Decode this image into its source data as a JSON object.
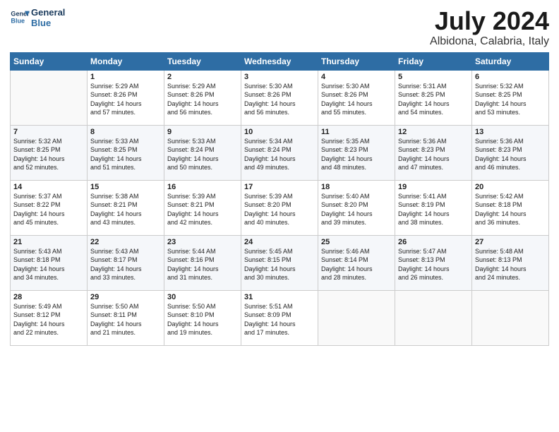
{
  "logo": {
    "line1": "General",
    "line2": "Blue"
  },
  "title": "July 2024",
  "location": "Albidona, Calabria, Italy",
  "header_days": [
    "Sunday",
    "Monday",
    "Tuesday",
    "Wednesday",
    "Thursday",
    "Friday",
    "Saturday"
  ],
  "weeks": [
    [
      {
        "day": "",
        "info": ""
      },
      {
        "day": "1",
        "info": "Sunrise: 5:29 AM\nSunset: 8:26 PM\nDaylight: 14 hours\nand 57 minutes."
      },
      {
        "day": "2",
        "info": "Sunrise: 5:29 AM\nSunset: 8:26 PM\nDaylight: 14 hours\nand 56 minutes."
      },
      {
        "day": "3",
        "info": "Sunrise: 5:30 AM\nSunset: 8:26 PM\nDaylight: 14 hours\nand 56 minutes."
      },
      {
        "day": "4",
        "info": "Sunrise: 5:30 AM\nSunset: 8:26 PM\nDaylight: 14 hours\nand 55 minutes."
      },
      {
        "day": "5",
        "info": "Sunrise: 5:31 AM\nSunset: 8:25 PM\nDaylight: 14 hours\nand 54 minutes."
      },
      {
        "day": "6",
        "info": "Sunrise: 5:32 AM\nSunset: 8:25 PM\nDaylight: 14 hours\nand 53 minutes."
      }
    ],
    [
      {
        "day": "7",
        "info": "Sunrise: 5:32 AM\nSunset: 8:25 PM\nDaylight: 14 hours\nand 52 minutes."
      },
      {
        "day": "8",
        "info": "Sunrise: 5:33 AM\nSunset: 8:25 PM\nDaylight: 14 hours\nand 51 minutes."
      },
      {
        "day": "9",
        "info": "Sunrise: 5:33 AM\nSunset: 8:24 PM\nDaylight: 14 hours\nand 50 minutes."
      },
      {
        "day": "10",
        "info": "Sunrise: 5:34 AM\nSunset: 8:24 PM\nDaylight: 14 hours\nand 49 minutes."
      },
      {
        "day": "11",
        "info": "Sunrise: 5:35 AM\nSunset: 8:23 PM\nDaylight: 14 hours\nand 48 minutes."
      },
      {
        "day": "12",
        "info": "Sunrise: 5:36 AM\nSunset: 8:23 PM\nDaylight: 14 hours\nand 47 minutes."
      },
      {
        "day": "13",
        "info": "Sunrise: 5:36 AM\nSunset: 8:23 PM\nDaylight: 14 hours\nand 46 minutes."
      }
    ],
    [
      {
        "day": "14",
        "info": "Sunrise: 5:37 AM\nSunset: 8:22 PM\nDaylight: 14 hours\nand 45 minutes."
      },
      {
        "day": "15",
        "info": "Sunrise: 5:38 AM\nSunset: 8:21 PM\nDaylight: 14 hours\nand 43 minutes."
      },
      {
        "day": "16",
        "info": "Sunrise: 5:39 AM\nSunset: 8:21 PM\nDaylight: 14 hours\nand 42 minutes."
      },
      {
        "day": "17",
        "info": "Sunrise: 5:39 AM\nSunset: 8:20 PM\nDaylight: 14 hours\nand 40 minutes."
      },
      {
        "day": "18",
        "info": "Sunrise: 5:40 AM\nSunset: 8:20 PM\nDaylight: 14 hours\nand 39 minutes."
      },
      {
        "day": "19",
        "info": "Sunrise: 5:41 AM\nSunset: 8:19 PM\nDaylight: 14 hours\nand 38 minutes."
      },
      {
        "day": "20",
        "info": "Sunrise: 5:42 AM\nSunset: 8:18 PM\nDaylight: 14 hours\nand 36 minutes."
      }
    ],
    [
      {
        "day": "21",
        "info": "Sunrise: 5:43 AM\nSunset: 8:18 PM\nDaylight: 14 hours\nand 34 minutes."
      },
      {
        "day": "22",
        "info": "Sunrise: 5:43 AM\nSunset: 8:17 PM\nDaylight: 14 hours\nand 33 minutes."
      },
      {
        "day": "23",
        "info": "Sunrise: 5:44 AM\nSunset: 8:16 PM\nDaylight: 14 hours\nand 31 minutes."
      },
      {
        "day": "24",
        "info": "Sunrise: 5:45 AM\nSunset: 8:15 PM\nDaylight: 14 hours\nand 30 minutes."
      },
      {
        "day": "25",
        "info": "Sunrise: 5:46 AM\nSunset: 8:14 PM\nDaylight: 14 hours\nand 28 minutes."
      },
      {
        "day": "26",
        "info": "Sunrise: 5:47 AM\nSunset: 8:13 PM\nDaylight: 14 hours\nand 26 minutes."
      },
      {
        "day": "27",
        "info": "Sunrise: 5:48 AM\nSunset: 8:13 PM\nDaylight: 14 hours\nand 24 minutes."
      }
    ],
    [
      {
        "day": "28",
        "info": "Sunrise: 5:49 AM\nSunset: 8:12 PM\nDaylight: 14 hours\nand 22 minutes."
      },
      {
        "day": "29",
        "info": "Sunrise: 5:50 AM\nSunset: 8:11 PM\nDaylight: 14 hours\nand 21 minutes."
      },
      {
        "day": "30",
        "info": "Sunrise: 5:50 AM\nSunset: 8:10 PM\nDaylight: 14 hours\nand 19 minutes."
      },
      {
        "day": "31",
        "info": "Sunrise: 5:51 AM\nSunset: 8:09 PM\nDaylight: 14 hours\nand 17 minutes."
      },
      {
        "day": "",
        "info": ""
      },
      {
        "day": "",
        "info": ""
      },
      {
        "day": "",
        "info": ""
      }
    ]
  ]
}
